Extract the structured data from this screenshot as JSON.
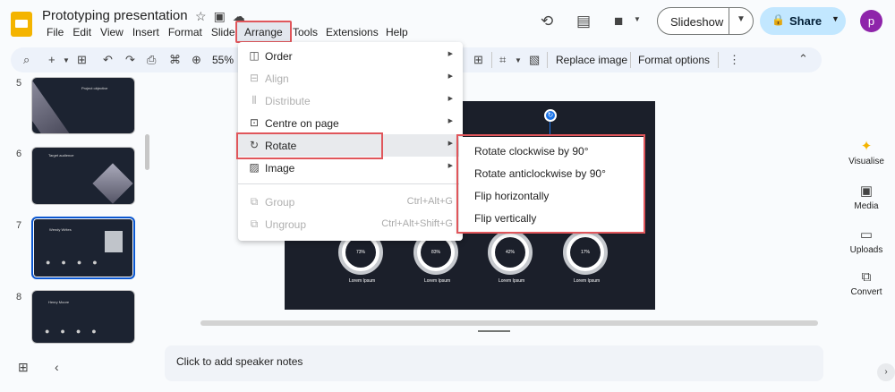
{
  "app": {
    "title": "Prototyping presentation",
    "avatar_letter": "p"
  },
  "menubar": {
    "items": [
      "File",
      "Edit",
      "View",
      "Insert",
      "Format",
      "Slide"
    ],
    "arrange": "Arrange",
    "items_after": [
      "Tools",
      "Extensions",
      "Help"
    ]
  },
  "header": {
    "slideshow": "Slideshow",
    "share": "Share"
  },
  "toolbar": {
    "zoom": "55%",
    "replace_image": "Replace image",
    "format_options": "Format options"
  },
  "filmstrip": {
    "slides": [
      {
        "number": "5",
        "title": "Project objective"
      },
      {
        "number": "6",
        "title": "Target audience"
      },
      {
        "number": "7",
        "title": "Wendy Writes"
      },
      {
        "number": "8",
        "title": "Henry Moore"
      }
    ]
  },
  "slide": {
    "stats": [
      {
        "value": "73%",
        "label": "Lorem Ipsum"
      },
      {
        "value": "83%",
        "label": "Lorem Ipsum"
      },
      {
        "value": "42%",
        "label": "Lorem Ipsum"
      },
      {
        "value": "17%",
        "label": "Lorem Ipsum"
      }
    ]
  },
  "arrange_menu": {
    "order": "Order",
    "align": "Align",
    "distribute": "Distribute",
    "centre": "Centre on page",
    "rotate": "Rotate",
    "image": "Image",
    "group": "Group",
    "group_shortcut": "Ctrl+Alt+G",
    "ungroup": "Ungroup",
    "ungroup_shortcut": "Ctrl+Alt+Shift+G"
  },
  "rotate_submenu": {
    "cw": "Rotate clockwise by 90°",
    "acw": "Rotate anticlockwise by 90°",
    "flip_h": "Flip horizontally",
    "flip_v": "Flip vertically"
  },
  "side_panel": {
    "visualise": "Visualise",
    "media": "Media",
    "uploads": "Uploads",
    "convert": "Convert"
  },
  "notes": {
    "placeholder": "Click to add speaker notes"
  },
  "colors": {
    "accent": "#0b57d0",
    "highlight": "#e0565b",
    "share_bg": "#c2e7ff",
    "slide_bg": "#1b1f2a"
  }
}
